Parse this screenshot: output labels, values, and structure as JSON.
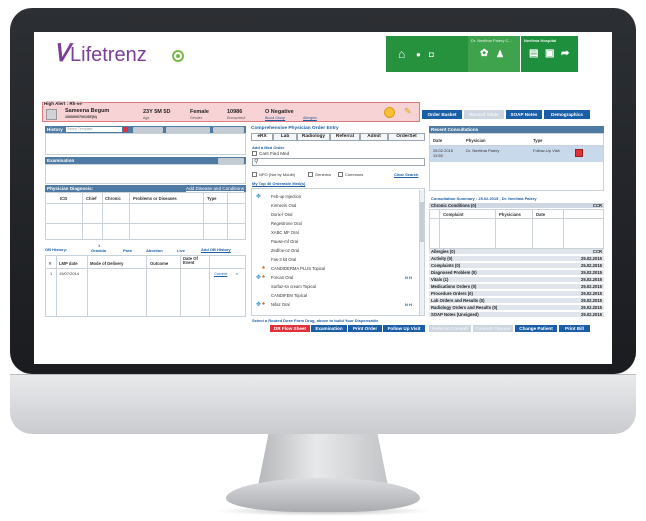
{
  "app": {
    "logo_text": "Lifetrenz",
    "header_user": "Dr. Neelima Palery C...",
    "header_hospital": "Neelima Hospital"
  },
  "alert": {
    "title": "High Alert : Rh-ve",
    "patient_name": "Sameena Begum",
    "patient_id": "10000007001SE(N)",
    "age_value": "23Y 5M 5D",
    "age_label": "Age",
    "gender_value": "Female",
    "gender_label": "Gender",
    "encounter_value": "10986",
    "encounter_label": "Encounter#",
    "blood_value": "O Negative",
    "blood_label": "Blood Group",
    "allergies_label": "Allergies"
  },
  "top_buttons": {
    "order_basket": "Order Basket",
    "record_vitals": "Record Vitals",
    "soap_notes": "SOAP Notes",
    "demographics": "Demographics"
  },
  "history": {
    "title": "History",
    "select_placeholder": "Select Template",
    "examination": "Examination"
  },
  "diagnosis": {
    "title": "Physician Diagnosis:",
    "add_link": "Add Disease and Conditions",
    "columns": [
      "ICD",
      "Chief",
      "Chronic",
      "Problems or Diseases",
      "Type"
    ]
  },
  "ob_history": {
    "title": "OB History:",
    "gravida": "Gravida",
    "gravida_num": "1",
    "para": "Para",
    "abortion": "Abortion",
    "live": "Live",
    "add_link": "Add OB History",
    "columns": [
      "#",
      "LMP date",
      "Mode of Delivery",
      "Outcome",
      "Date Of Event",
      ""
    ],
    "rows": [
      {
        "num": "1",
        "lmp": "19/07/2014",
        "status": "Current",
        "action": "x"
      }
    ]
  },
  "order_entry": {
    "title": "Comprehensive Physician Order Entry",
    "tabs": [
      "eRX",
      "Lab",
      "Radiology",
      "Referral",
      "Admit",
      "OrderSet"
    ],
    "add_med": "Add a Med Order",
    "cant_find": "Cant Find Med",
    "npo": "NPO (Not by Mouth)",
    "generics": "Generics",
    "commons": "Commons",
    "clear_search": "Clear Search",
    "top_meds_title": "My Top 40 Orderable Med(s)",
    "meds": [
      "Feb-up Injection",
      "Kirmezin Oral",
      "Dorix-f Oral",
      "Regestrone Oral",
      "XABC MF Oral",
      "Pause-mf Oral",
      "Zedfoe-oz Oral",
      "Fas-3 kit Oral",
      "CANDIDERMA PLUS Topical",
      "Forcan Oral",
      "Surfaz-sn cream Topical",
      "CANDIFEM Topical",
      "Nifaz Oral"
    ],
    "footer_note": "Select a Routed Dose Form Drug, above to build Your Dispensable"
  },
  "bottom_buttons": {
    "dr_flow_sheet": "DR Flow Sheet",
    "examination": "Examination",
    "print_order": "Print Order",
    "follow_up_visit": "Follow Up Visit",
    "referral_consult": "Referral Consult",
    "consult_closure": "Consult Closure",
    "change_patient": "Change Patient",
    "print_bill": "Print Bill"
  },
  "recent_consultations": {
    "title": "Recent Consultations",
    "columns": [
      "Date",
      "Physician",
      "Type"
    ],
    "rows": [
      {
        "date": "25.02.2015 13:50",
        "physician": "Dr. Neelima Palery",
        "type": "Follow-Up Visit"
      }
    ]
  },
  "summary": {
    "title": "Consultation Summary : 25.02.2015 , Dr. Neelima Palery",
    "chronic_label": "Chronic Conditions (0)",
    "chronic_code": "CCR",
    "complaint_cols": [
      "Complaint",
      "Physicians",
      "Date"
    ],
    "rows": [
      {
        "label": "Allergies (0)",
        "date": "CCR"
      },
      {
        "label": "Activity (0)",
        "date": "25.02.2015"
      },
      {
        "label": "Complaints (0)",
        "date": "25.02.2015"
      },
      {
        "label": "Diagnosed Problem (0)",
        "date": "25.02.2015"
      },
      {
        "label": "Vitals (1)",
        "date": "25.02.2015"
      },
      {
        "label": "Medications Orders (0)",
        "date": "25.02.2015"
      },
      {
        "label": "Procedure Orders (0)",
        "date": "25.02.2015"
      },
      {
        "label": "Lab Orders and Results (0)",
        "date": "25.02.2015"
      },
      {
        "label": "Radiology Orders and Results (0)",
        "date": "25.02.2015"
      },
      {
        "label": "SOAP Notes (Unsigned)",
        "date": "25.02.2015"
      }
    ]
  },
  "colors": {
    "brand": "#7b3f98",
    "header_green": "#1e8f3d",
    "panel_bar": "#4e7aa3",
    "button_blue": "#1a5ea8",
    "alert_bg": "#f8d3d5",
    "danger_red": "#e0303a"
  }
}
